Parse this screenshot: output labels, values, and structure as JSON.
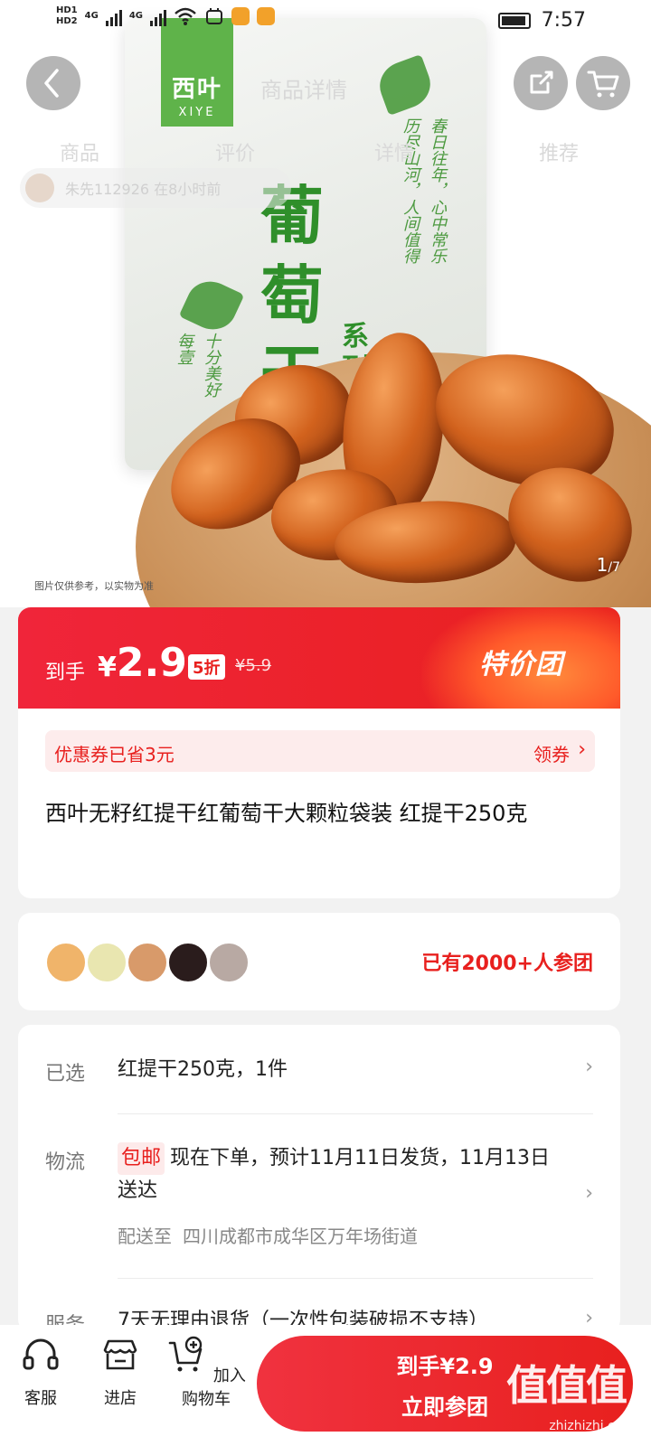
{
  "status_bar": {
    "sim1": "HD1",
    "sim2": "HD2",
    "net1": "4G",
    "net2": "4G",
    "time": "7:57"
  },
  "header": {
    "title": "商品详情",
    "tabs": [
      "商品",
      "评价",
      "详情",
      "推荐"
    ],
    "ticker_text": "朱先112926 在8小时前",
    "icons": {
      "back": "back-arrow-icon",
      "share": "share-icon",
      "cart": "cart-icon"
    }
  },
  "hero": {
    "brand_cn": "西叶",
    "brand_en": "XIYE",
    "bag_title": "葡萄干",
    "bag_series": "系列",
    "poem_right": [
      "春日往年，心中常乐",
      "历尽山河，人间值得"
    ],
    "poem_left": [
      "十分美好",
      "每壹"
    ],
    "caption": "图片仅供参考，以实物为准",
    "image_index": "1",
    "image_total": "/7"
  },
  "price_banner": {
    "prefix": "到手",
    "currency": "¥",
    "price": "2.9",
    "discount": "5折",
    "original": "¥5.9",
    "campaign": "特价团"
  },
  "coupon": {
    "text": "优惠券已省3元",
    "action": "领券",
    "chevron": "›"
  },
  "product": {
    "title": "西叶无籽红提干红葡萄干大颗粒袋装 红提干250克"
  },
  "group": {
    "text": "已有2000+人参团",
    "avatar_colors": [
      "#f0b46a",
      "#e9e6b0",
      "#d89a6a",
      "#2a1c1c",
      "#b8a9a3"
    ]
  },
  "options": {
    "selected_label": "已选",
    "selected_value": "红提干250克，1件",
    "logistics_label": "物流",
    "free_shipping": "包邮",
    "logistics_value": "现在下单，预计11月11日发货，11月13日送达",
    "ship_to_label": "配送至",
    "ship_to_value": "四川成都市成华区万年场街道",
    "service_label": "服务",
    "service_value": "7天无理由退货（一次性包装破损不支持）",
    "chevron": "›"
  },
  "bottom_bar": {
    "service": "客服",
    "store": "进店",
    "add_cart": "加入购物车",
    "buy_price": "到手¥2.9",
    "buy_label": "立即参团"
  },
  "watermark": {
    "logo": "值值值",
    "url": "zhizhizhi.com"
  },
  "colors": {
    "accent_red": "#e8201e",
    "brand_green": "#5fb34a",
    "coupon_bg": "#fdecec"
  }
}
